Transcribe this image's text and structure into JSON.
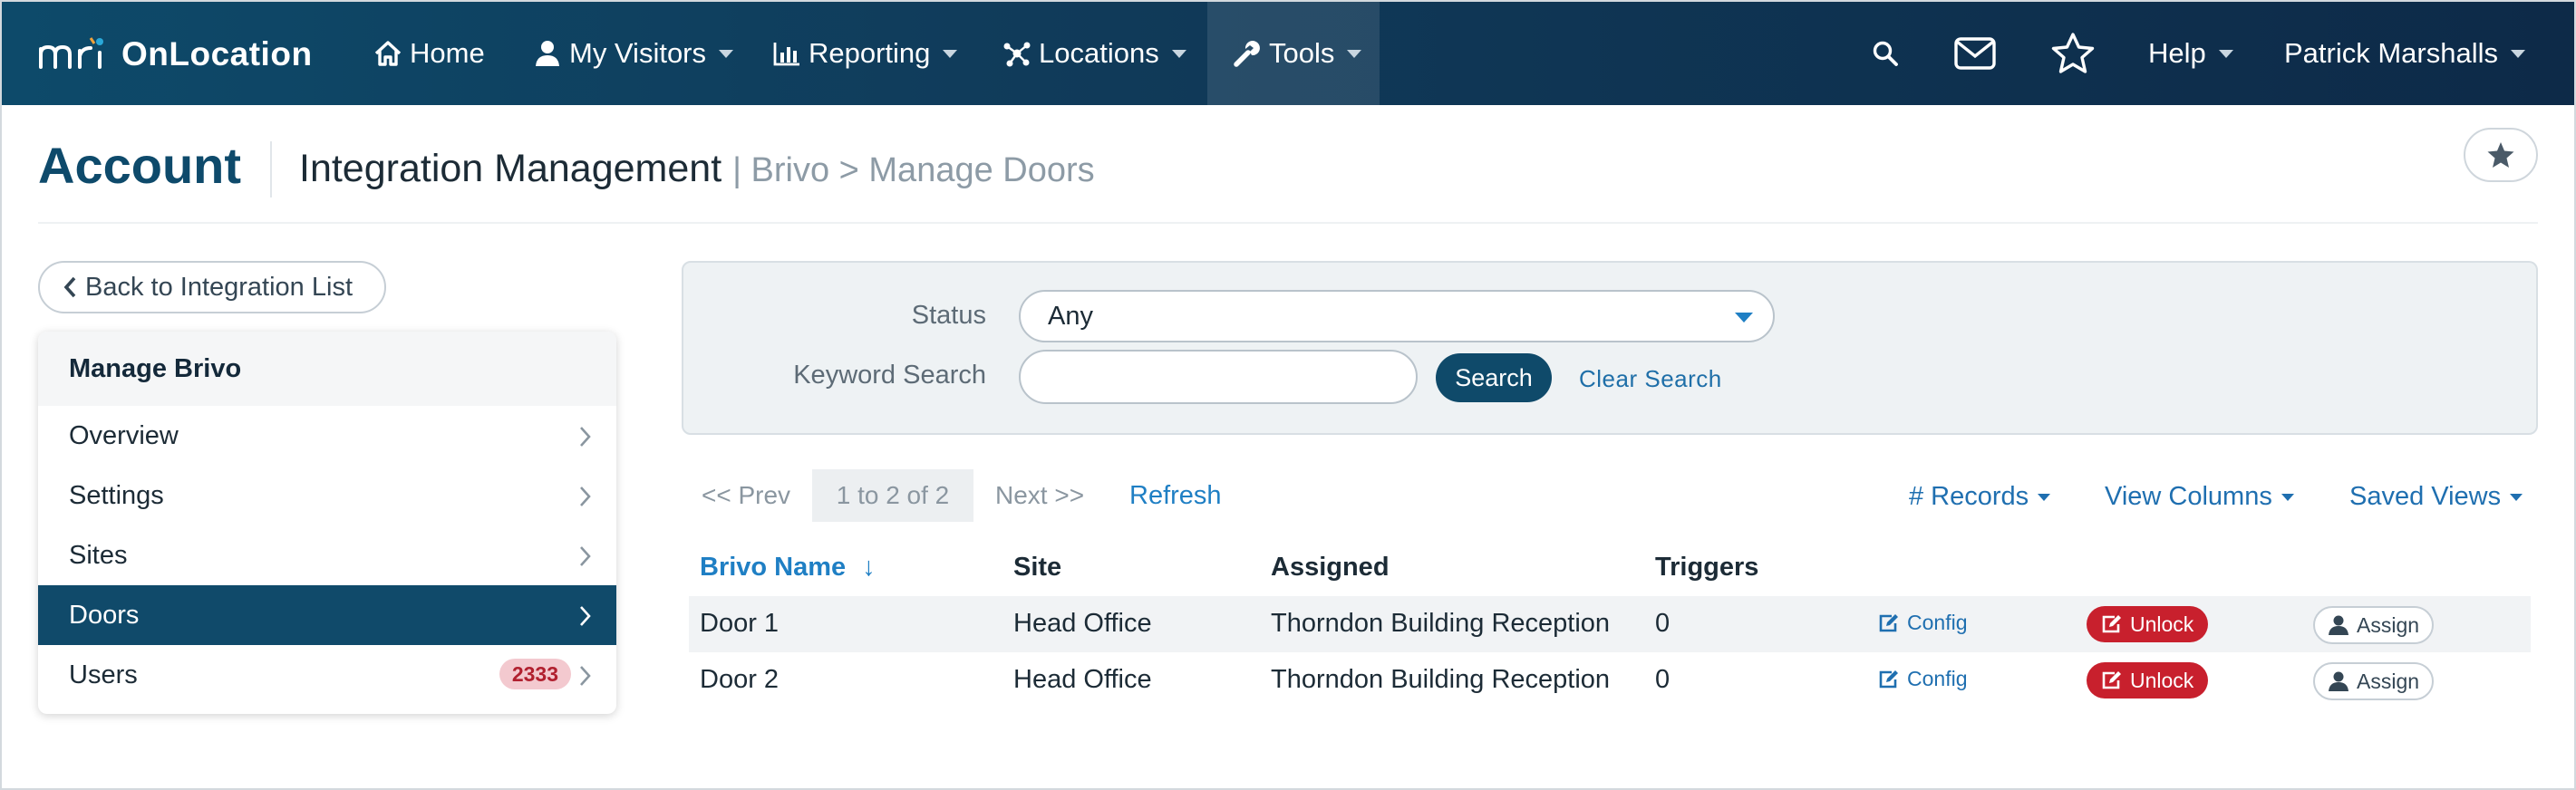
{
  "nav": {
    "brand_mark": "mri",
    "brand_name": "OnLocation",
    "items": [
      {
        "label": "Home",
        "icon": "home-icon"
      },
      {
        "label": "My Visitors",
        "icon": "user-icon"
      },
      {
        "label": "Reporting",
        "icon": "bar-chart-icon"
      },
      {
        "label": "Locations",
        "icon": "network-icon"
      },
      {
        "label": "Tools",
        "icon": "wrench-icon"
      }
    ],
    "help_label": "Help",
    "user_name": "Patrick Marshalls",
    "icons": [
      "search-icon",
      "mail-icon",
      "star-icon"
    ]
  },
  "header": {
    "title": "Account",
    "subtitle": "Integration Management",
    "breadcrumb": "| Brivo > Manage Doors"
  },
  "sidebar": {
    "back_label": "Back to Integration List",
    "heading": "Manage Brivo",
    "items": [
      {
        "label": "Overview"
      },
      {
        "label": "Settings"
      },
      {
        "label": "Sites"
      },
      {
        "label": "Doors",
        "active": true
      },
      {
        "label": "Users",
        "badge": "2333"
      }
    ]
  },
  "filters": {
    "status_label": "Status",
    "status_value": "Any",
    "keyword_label": "Keyword Search",
    "keyword_value": "",
    "search_label": "Search",
    "clear_label": "Clear Search"
  },
  "pager": {
    "prev": "<< Prev",
    "info": "1 to 2 of 2",
    "next": "Next >>",
    "refresh": "Refresh"
  },
  "toolbar": {
    "records": "# Records",
    "view_columns": "View Columns",
    "saved_views": "Saved Views"
  },
  "table": {
    "columns": {
      "name": "Brivo Name",
      "sort_arrow": "↓",
      "site": "Site",
      "assigned": "Assigned",
      "triggers": "Triggers"
    },
    "rows": [
      {
        "name": "Door 1",
        "site": "Head Office",
        "assigned": "Thorndon Building Reception",
        "triggers": "0",
        "config": "Config",
        "unlock": "Unlock",
        "assign": "Assign"
      },
      {
        "name": "Door 2",
        "site": "Head Office",
        "assigned": "Thorndon Building Reception",
        "triggers": "0",
        "config": "Config",
        "unlock": "Unlock",
        "assign": "Assign"
      }
    ]
  },
  "colors": {
    "nav_start": "#0d4a6a",
    "nav_end": "#0d2a48",
    "accent": "#1f7fc4",
    "active_item": "#104a6a",
    "danger": "#c8202d",
    "badge_bg": "#f3c9cf"
  }
}
